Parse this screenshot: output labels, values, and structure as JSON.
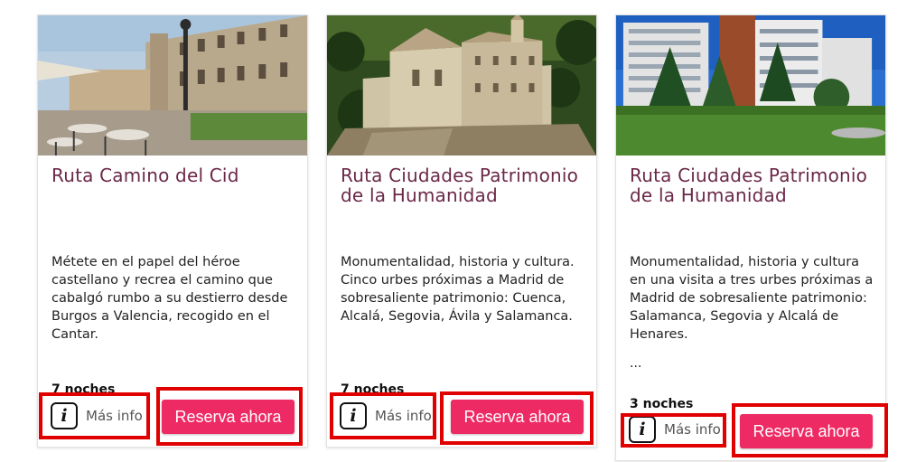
{
  "cards": [
    {
      "image": "hotel-courtyard-terrace-photo",
      "title": "Ruta Camino del Cid",
      "description": "Métete en el papel del héroe castellano y recrea el camino que cabalgó rumbo a su destierro desde Burgos a Valencia, recogido en el Cantar.",
      "ellipsis": "",
      "nights": "7 noches",
      "info_label": "Más info",
      "reserve_label": "Reserva ahora"
    },
    {
      "image": "clifftop-convent-photo",
      "title": "Ruta Ciudades Patrimonio de la Humanidad",
      "description": "Monumentalidad, historia y cultura. Cinco urbes próximas a Madrid de sobresaliente patrimonio: Cuenca, Alcalá, Segovia, Ávila y Salamanca.",
      "ellipsis": "",
      "nights": "7 noches",
      "info_label": "Más info",
      "reserve_label": "Reserva ahora"
    },
    {
      "image": "modern-hotel-garden-photo",
      "title": "Ruta Ciudades Patrimonio de la Humanidad",
      "description": "Monumentalidad, historia y cultura en una visita a tres urbes próximas a Madrid de sobresaliente patrimonio: Salamanca, Segovia y Alcalá de Henares.",
      "ellipsis": "...",
      "nights": "3 noches",
      "info_label": "Más info",
      "reserve_label": "Reserva ahora"
    }
  ],
  "icons": {
    "info": "info-icon"
  },
  "colors": {
    "title": "#6b2848",
    "button": "#ee2a64",
    "highlight": "#e00000"
  }
}
